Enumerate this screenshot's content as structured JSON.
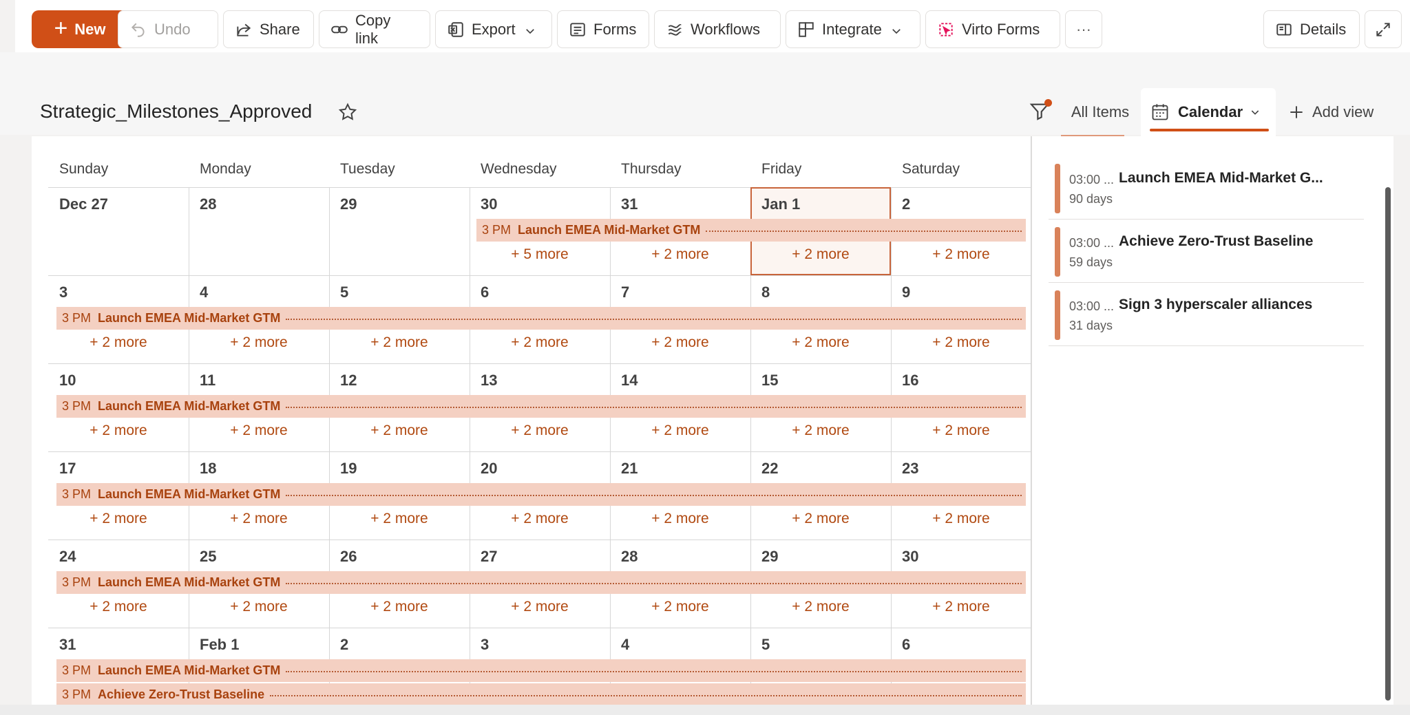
{
  "toolbar": {
    "new_label": "New",
    "undo_label": "Undo",
    "share_label": "Share",
    "copy_link_label": "Copy link",
    "export_label": "Export",
    "forms_label": "Forms",
    "workflows_label": "Workflows",
    "integrate_label": "Integrate",
    "virto_label": "Virto Forms",
    "more_label": "···",
    "details_label": "Details"
  },
  "header": {
    "title": "Strategic_Milestones_Approved",
    "views": {
      "all_items": "All Items",
      "calendar": "Calendar",
      "add_view": "Add view"
    }
  },
  "colors": {
    "accent": "#d04f17",
    "event_bg": "#f4d0c2",
    "event_text": "#a8420e"
  },
  "calendar": {
    "weekdays": [
      "Sunday",
      "Monday",
      "Tuesday",
      "Wednesday",
      "Thursday",
      "Friday",
      "Saturday"
    ],
    "weeks": [
      {
        "days": [
          "Dec 27",
          "28",
          "29",
          "30",
          "31",
          "Jan 1",
          "2"
        ],
        "more": [
          "",
          "",
          "",
          "+ 5 more",
          "+ 2 more",
          "+ 2 more",
          "+ 2 more"
        ]
      },
      {
        "days": [
          "3",
          "4",
          "5",
          "6",
          "7",
          "8",
          "9"
        ],
        "more": [
          "+ 2 more",
          "+ 2 more",
          "+ 2 more",
          "+ 2 more",
          "+ 2 more",
          "+ 2 more",
          "+ 2 more"
        ]
      },
      {
        "days": [
          "10",
          "11",
          "12",
          "13",
          "14",
          "15",
          "16"
        ],
        "more": [
          "+ 2 more",
          "+ 2 more",
          "+ 2 more",
          "+ 2 more",
          "+ 2 more",
          "+ 2 more",
          "+ 2 more"
        ]
      },
      {
        "days": [
          "17",
          "18",
          "19",
          "20",
          "21",
          "22",
          "23"
        ],
        "more": [
          "+ 2 more",
          "+ 2 more",
          "+ 2 more",
          "+ 2 more",
          "+ 2 more",
          "+ 2 more",
          "+ 2 more"
        ]
      },
      {
        "days": [
          "24",
          "25",
          "26",
          "27",
          "28",
          "29",
          "30"
        ],
        "more": [
          "+ 2 more",
          "+ 2 more",
          "+ 2 more",
          "+ 2 more",
          "+ 2 more",
          "+ 2 more",
          "+ 2 more"
        ]
      },
      {
        "days": [
          "31",
          "Feb 1",
          "2",
          "3",
          "4",
          "5",
          "6"
        ],
        "more": [
          "",
          "",
          "",
          "",
          "",
          "",
          ""
        ]
      }
    ],
    "events": [
      {
        "time": "3 PM",
        "name": "Launch EMEA Mid-Market GTM"
      },
      {
        "time": "3 PM",
        "name": "Launch EMEA Mid-Market GTM"
      },
      {
        "time": "3 PM",
        "name": "Launch EMEA Mid-Market GTM"
      },
      {
        "time": "3 PM",
        "name": "Launch EMEA Mid-Market GTM"
      },
      {
        "time": "3 PM",
        "name": "Launch EMEA Mid-Market GTM"
      },
      {
        "time": "3 PM",
        "name": "Launch EMEA Mid-Market GTM"
      },
      {
        "time": "3 PM",
        "name": "Achieve Zero-Trust Baseline"
      }
    ]
  },
  "sidebar": {
    "items": [
      {
        "time": "03:00 ...",
        "duration": "90 days",
        "title": "Launch EMEA Mid-Market G..."
      },
      {
        "time": "03:00 ...",
        "duration": "59 days",
        "title": "Achieve Zero-Trust Baseline"
      },
      {
        "time": "03:00 ...",
        "duration": "31 days",
        "title": "Sign 3 hyperscaler alliances"
      }
    ]
  }
}
